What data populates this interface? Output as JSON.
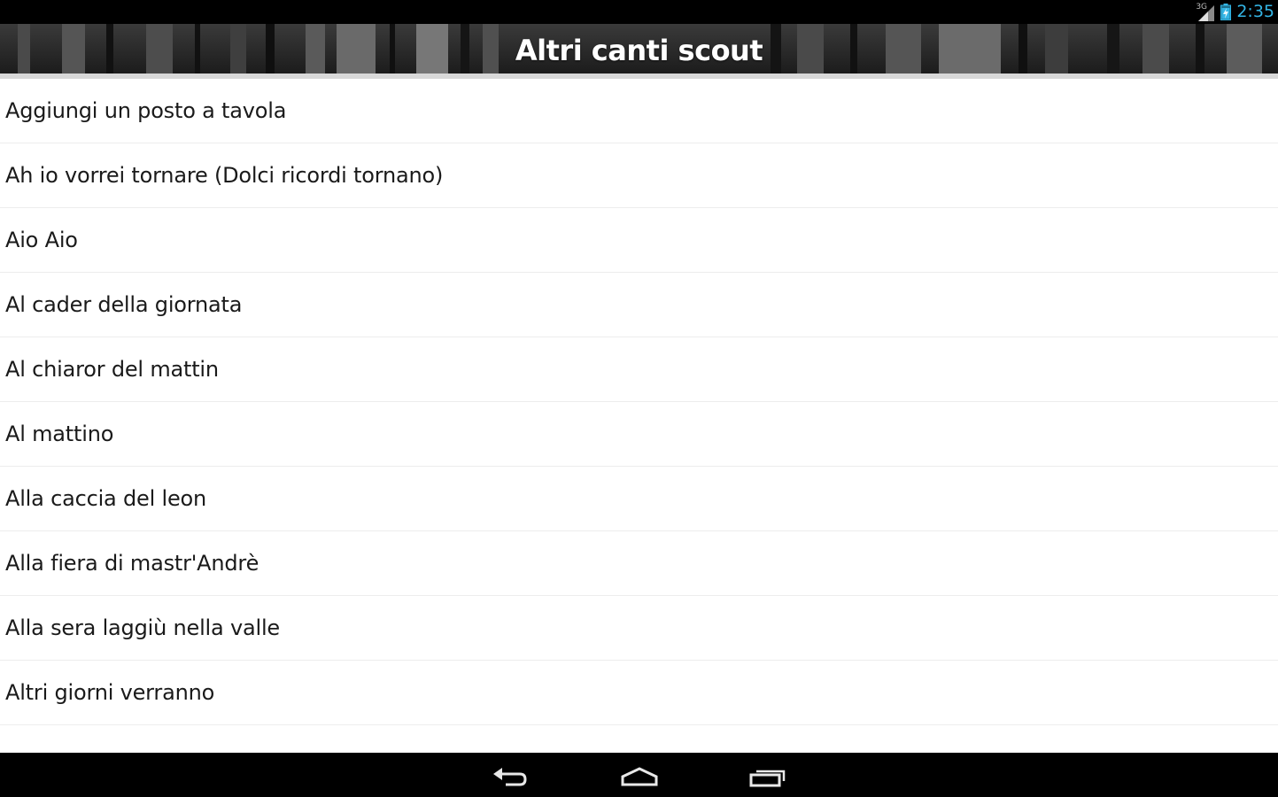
{
  "status_bar": {
    "network_type": "3G",
    "clock": "2:35",
    "icons": [
      "signal-icon",
      "battery-icon"
    ]
  },
  "action_bar": {
    "title": "Altri canti scout"
  },
  "songs": [
    "Aggiungi un posto a tavola",
    "Ah io vorrei tornare (Dolci ricordi tornano)",
    "Aio Aio",
    "Al cader della giornata",
    "Al chiaror del mattin",
    "Al mattino",
    "Alla caccia del leon",
    "Alla fiera di mastr'Andrè",
    "Alla sera laggiù nella valle",
    "Altri giorni verranno",
    ""
  ],
  "navigation_bar": {
    "icons": [
      "back-icon",
      "home-icon",
      "recent-apps-icon"
    ]
  },
  "colors": {
    "clock": "#33b5e5",
    "status_bar": "#000000",
    "list_background": "#ffffff",
    "divider": "#ededed"
  }
}
